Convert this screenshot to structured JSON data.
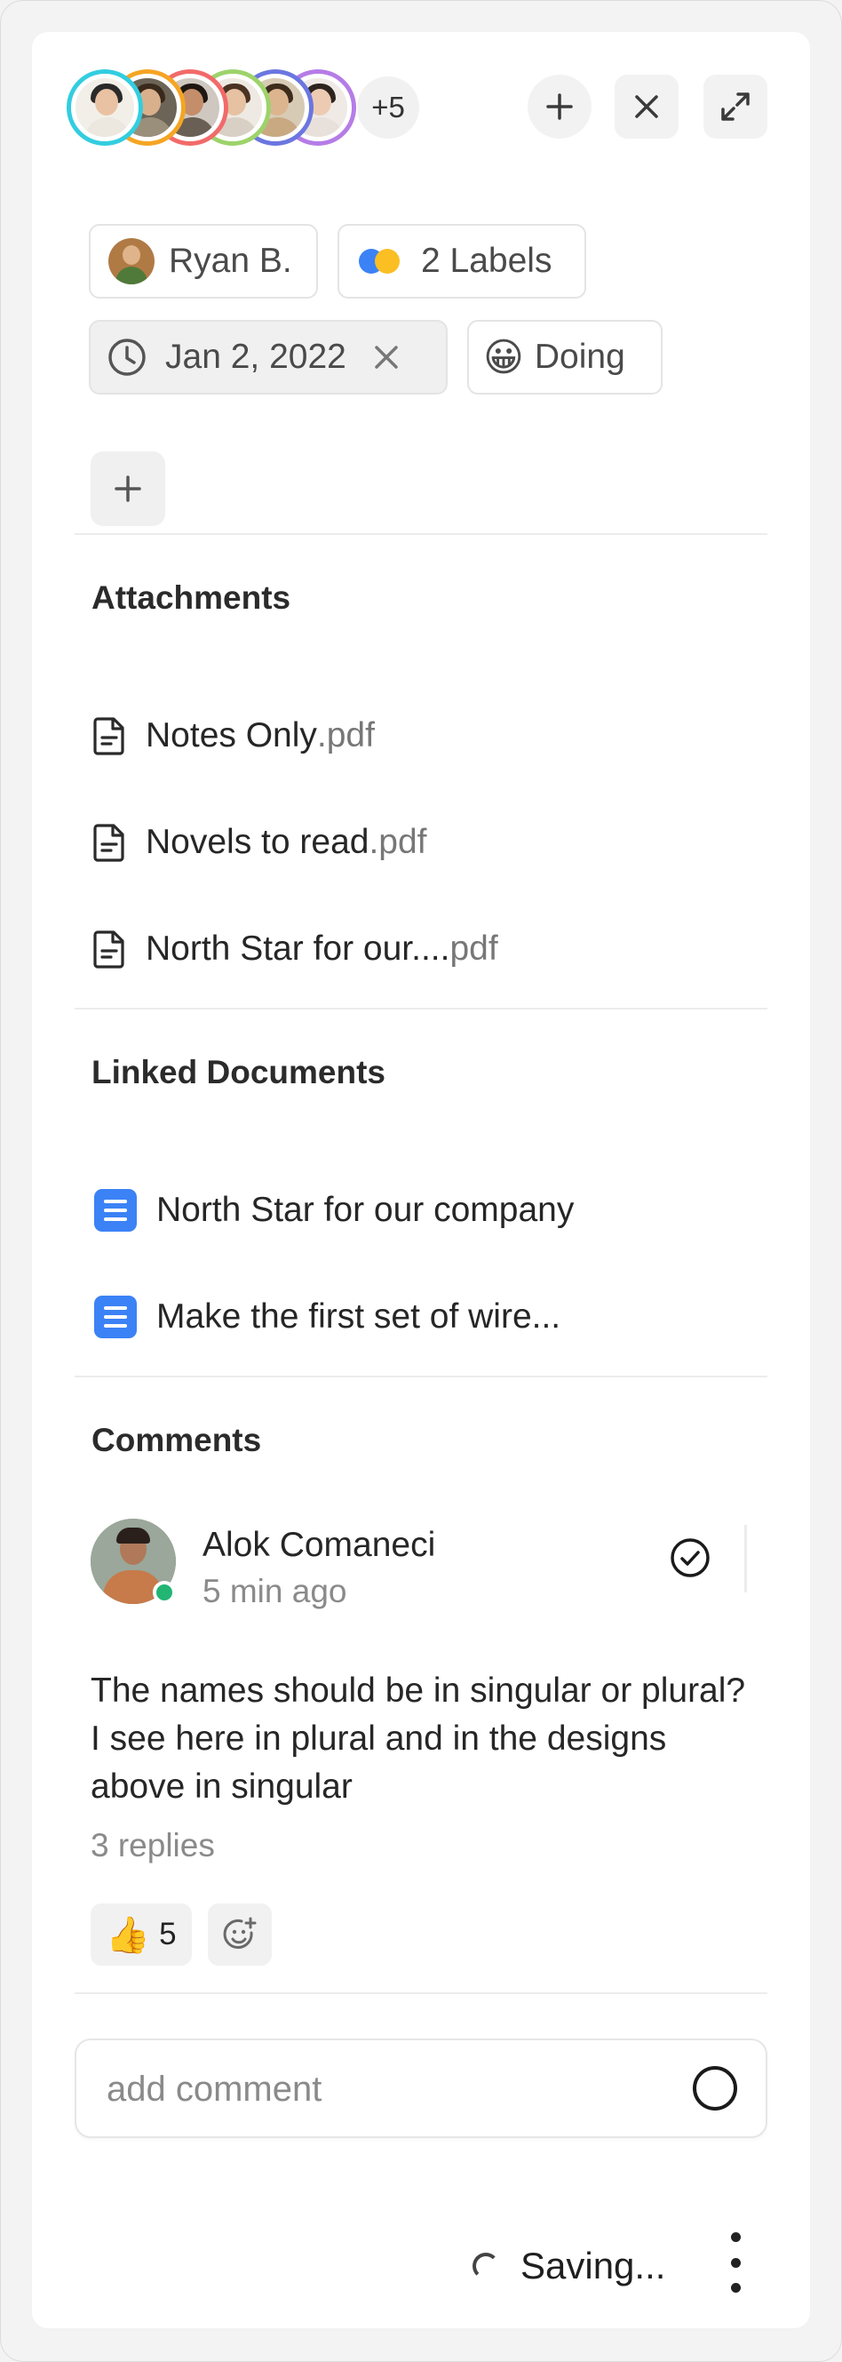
{
  "header": {
    "avatars": [
      {
        "name": "member-1",
        "ring": "#33cde0",
        "bg": "#f2efe9",
        "skin": "#e9c2a3",
        "hair": "#2a2a2a",
        "shirt": "#ece7df"
      },
      {
        "name": "member-2",
        "ring": "#f5a524",
        "bg": "#6b6457",
        "skin": "#d9b08c",
        "hair": "#3a2a1c",
        "shirt": "#9a8f7a"
      },
      {
        "name": "member-3",
        "ring": "#f26a6a",
        "bg": "#cfc8c0",
        "skin": "#c58e6a",
        "hair": "#1e1712",
        "shirt": "#6a5f55"
      },
      {
        "name": "member-4",
        "ring": "#9dd36b",
        "bg": "#eee9e2",
        "skin": "#e6c1a2",
        "hair": "#4a3322",
        "shirt": "#d8d0c4"
      },
      {
        "name": "member-5",
        "ring": "#6b76e0",
        "bg": "#d8cbb5",
        "skin": "#dcb58f",
        "hair": "#3d2b1c",
        "shirt": "#c9a982"
      },
      {
        "name": "member-6",
        "ring": "#b57ce6",
        "bg": "#efeae6",
        "skin": "#edcbb3",
        "hair": "#2d2420",
        "shirt": "#e8e0da"
      }
    ],
    "more_count": "+5",
    "add_icon": "plus-icon",
    "close_icon": "close-icon",
    "expand_icon": "expand-icon"
  },
  "properties": {
    "assignee": "Ryan B.",
    "labels": "2 Labels",
    "label_colors": [
      "#3b82f6",
      "#fbbf24"
    ],
    "due_date": "Jan 2, 2022",
    "status": "Doing",
    "status_emoji": "😀"
  },
  "attachments": {
    "title": "Attachments",
    "files": [
      {
        "name": "Notes Only",
        "ext": ".pdf"
      },
      {
        "name": "Novels to read",
        "ext": ".pdf"
      },
      {
        "name": "North Star for our....",
        "ext": "pdf"
      }
    ]
  },
  "linked_documents": {
    "title": "Linked Documents",
    "items": [
      "North Star for our company",
      "Make the first set of wire..."
    ]
  },
  "comments": {
    "title": "Comments",
    "items": [
      {
        "author": "Alok Comaneci",
        "time": "5 min ago",
        "text": "The names should be in singular or plural? I see here in plural and in the designs above in singular",
        "replies": "3 replies",
        "reaction_emoji": "👍",
        "reaction_count": "5"
      }
    ]
  },
  "composer": {
    "placeholder": "add comment"
  },
  "footer": {
    "status": "Saving..."
  }
}
